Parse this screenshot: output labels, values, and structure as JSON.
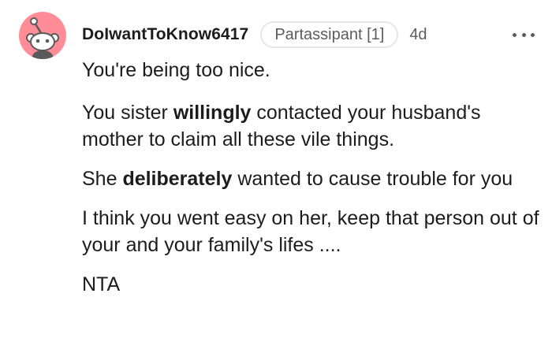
{
  "comment": {
    "author": "DoIwantToKnow6417",
    "flair": "Partassipant [1]",
    "age": "4d",
    "avatar_color": "#ff8c96",
    "more_icon": "more-horizontal-icon",
    "paragraphs": [
      {
        "text": "You're being too nice."
      },
      {
        "before": "You sister ",
        "bold": "willingly",
        "after": " contacted your husband's mother to claim all these vile things."
      },
      {
        "before": "She ",
        "bold": "deliberately",
        "after": " wanted to cause trouble for you"
      },
      {
        "text": "I think you went easy on her, keep that person out of your and your family's lifes ...."
      },
      {
        "text": "NTA"
      }
    ]
  }
}
